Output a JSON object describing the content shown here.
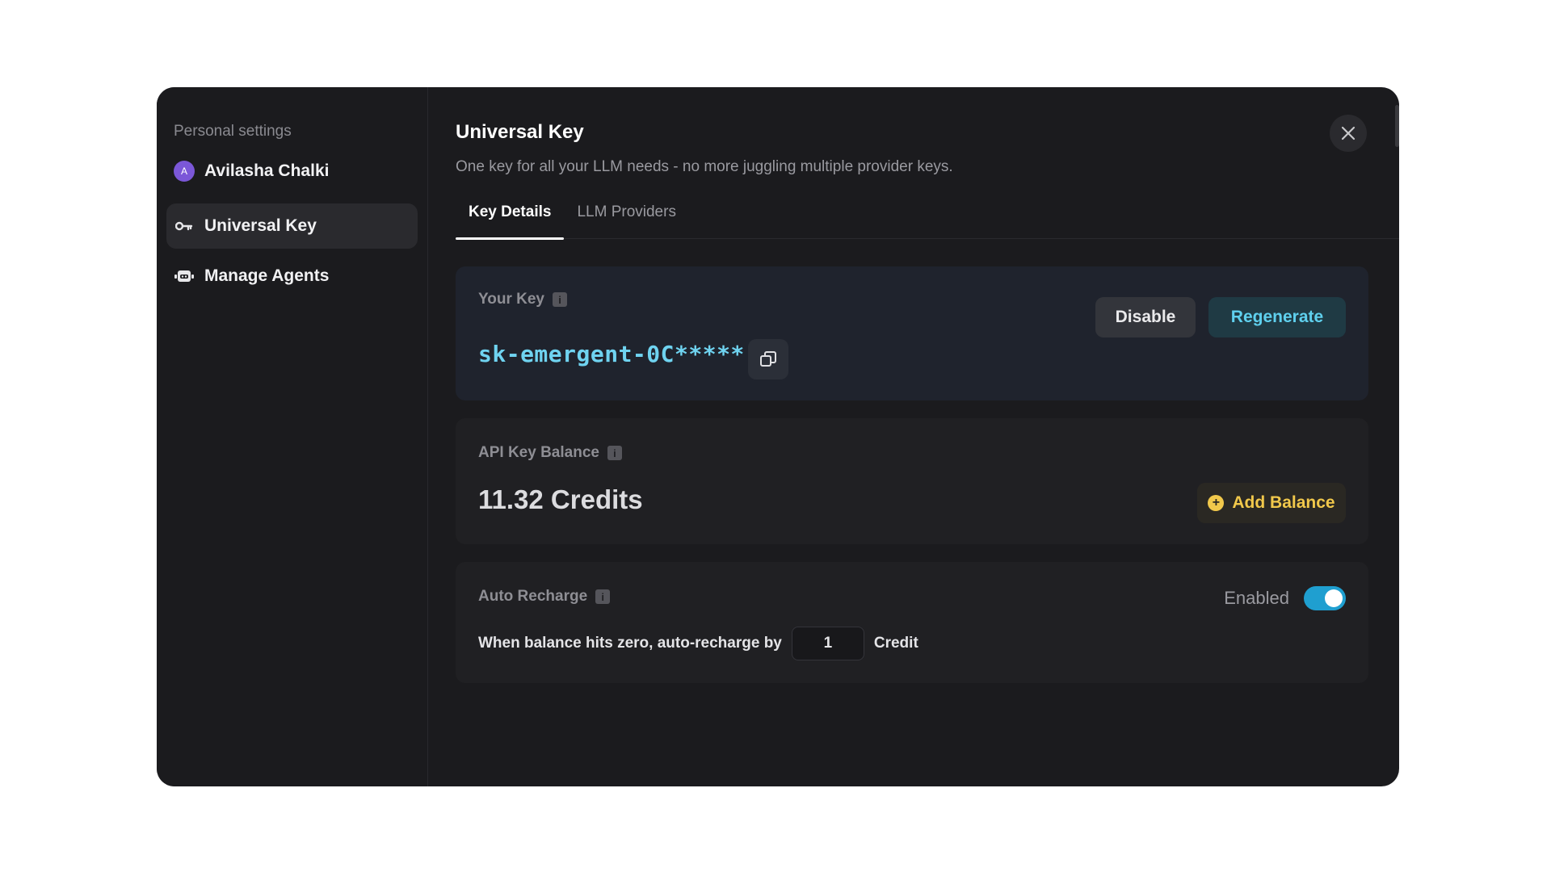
{
  "sidebar": {
    "title": "Personal settings",
    "user": {
      "initial": "A",
      "name": "Avilasha Chalki"
    },
    "items": [
      {
        "label": "Universal Key",
        "icon": "key-icon",
        "active": true
      },
      {
        "label": "Manage Agents",
        "icon": "robot-icon",
        "active": false
      }
    ]
  },
  "header": {
    "title": "Universal Key",
    "subtitle": "One key for all your LLM needs - no more juggling multiple provider keys."
  },
  "tabs": [
    {
      "label": "Key Details",
      "active": true
    },
    {
      "label": "LLM Providers",
      "active": false
    }
  ],
  "key_card": {
    "label": "Your Key",
    "value": "sk-emergent-0C*****",
    "disable_label": "Disable",
    "regenerate_label": "Regenerate"
  },
  "balance_card": {
    "label": "API Key Balance",
    "value": "11.32 Credits",
    "add_label": "Add Balance"
  },
  "auto_recharge": {
    "label": "Auto Recharge",
    "status": "Enabled",
    "enabled": true,
    "prefix": "When balance hits zero, auto-recharge by",
    "amount": "1",
    "unit": "Credit"
  },
  "colors": {
    "accent_cyan": "#6fd3f0",
    "toggle_on": "#1f9fd0",
    "add_balance_gold": "#f1c84b",
    "avatar_purple": "#7b57d8"
  }
}
